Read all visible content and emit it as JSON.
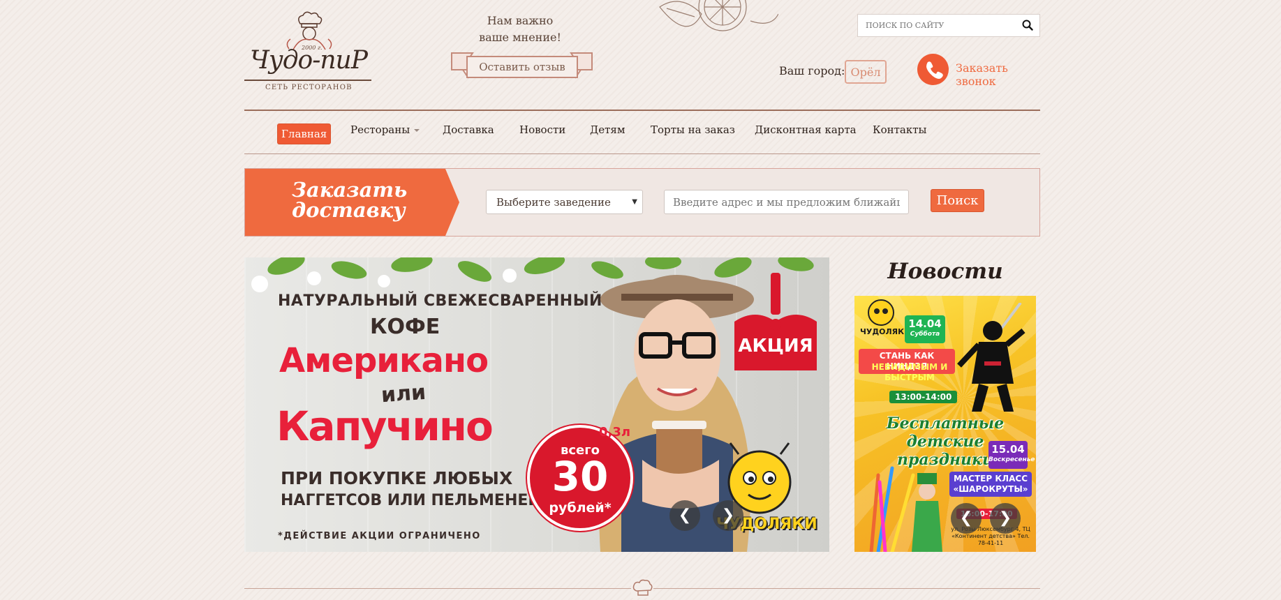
{
  "header": {
    "logo": {
      "name": "Чудо-пиР",
      "year": "2000 г.",
      "subtitle": "СЕТЬ РЕСТОРАНОВ"
    },
    "feedback": {
      "line1": "Нам важно",
      "line2": "ваше мнение!",
      "button": "Оставить отзыв"
    },
    "search": {
      "placeholder": "ПОИСК ПО САЙТУ",
      "icon": "search-icon"
    },
    "city": {
      "label": "Ваш город:",
      "value": "Орёл"
    },
    "call": {
      "label": "Заказать звонок",
      "icon": "phone-icon"
    }
  },
  "nav": {
    "items": [
      {
        "label": "Главная",
        "active": true
      },
      {
        "label": "Рестораны",
        "dropdown": true
      },
      {
        "label": "Доставка"
      },
      {
        "label": "Новости"
      },
      {
        "label": "Детям"
      },
      {
        "label": "Торты на заказ"
      },
      {
        "label": "Дисконтная карта"
      },
      {
        "label": "Контакты"
      }
    ]
  },
  "delivery": {
    "title_line1": "Заказать",
    "title_line2": "доставку",
    "select_value": "Выберите заведение",
    "address_placeholder": "Введите адрес и мы предложим ближайшее заведение",
    "button": "Поиск"
  },
  "promo": {
    "line1": "НАТУРАЛЬНЫЙ СВЕЖЕСВАРЕННЫЙ",
    "line2": "КОФЕ",
    "line3": "Американо",
    "line4": "или",
    "line5": "Капучино",
    "line6": "ПРИ ПОКУПКЕ ЛЮБЫХ",
    "line7": "НАГГЕТСОВ ИЛИ ПЕЛЬМЕНЕЙ",
    "note": "*ДЕЙСТВИЕ АКЦИИ ОГРАНИЧЕНО",
    "price_top": "всего",
    "price": "30",
    "price_unit": "рублей*",
    "volume": "0,3л",
    "badge": "АКЦИЯ",
    "cafe_name": "ЧУДОЛЯКИ",
    "prev": "❮",
    "next": "❯"
  },
  "news": {
    "title": "Новости",
    "card": {
      "brand": "ЧУДОЛЯКИ",
      "date1": "14.04",
      "day1": "Суббота",
      "headline1": "СТАНЬ КАК НИНДЗЯ",
      "headline2": "НЕВИДИМЫМ И БЫСТРЫМ",
      "time1": "13:00-14:00",
      "big": "Бесплатные детские праздники",
      "date2": "15.04",
      "day2": "Воскресенье",
      "masterclass": "МАСТЕР КЛАСС «ШАРОКРУТЫ»",
      "time2": "16:00-17:00",
      "address": "ул. Розы Люксембург 4, ТЦ «Континент детства» Тел. 78-41-11"
    },
    "prev": "❮",
    "next": "❯"
  },
  "colors": {
    "accent": "#ef5a34",
    "nav_border": "#9b6d5a",
    "promo_red": "#e8203a"
  }
}
